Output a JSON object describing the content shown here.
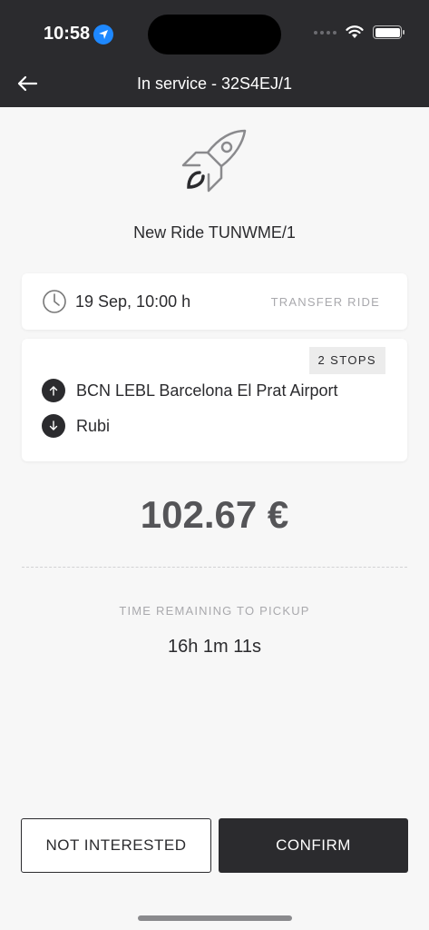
{
  "status_bar": {
    "time": "10:58"
  },
  "nav": {
    "title": "In service - 32S4EJ/1"
  },
  "ride": {
    "title": "New Ride TUNWME/1",
    "date": "19 Sep, 10:00 h",
    "type": "TRANSFER RIDE",
    "stops_badge": "2 STOPS",
    "pickup": "BCN LEBL Barcelona El Prat Airport",
    "dropoff": "Rubi",
    "price": "102.67 €",
    "remaining_label": "TIME REMAINING TO PICKUP",
    "remaining_value": "16h 1m 11s"
  },
  "actions": {
    "decline_label": "NOT INTERESTED",
    "confirm_label": "CONFIRM"
  },
  "colors": {
    "dark": "#2b2b2e",
    "background": "#f7f7f7",
    "location_blue": "#1e88ff"
  }
}
